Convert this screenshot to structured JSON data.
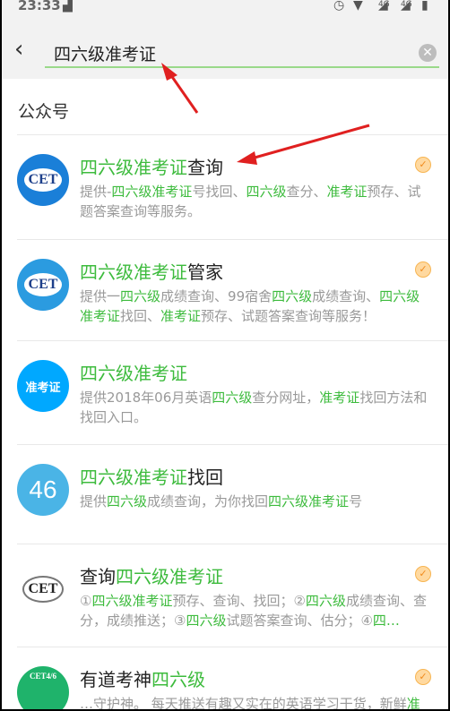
{
  "status_bar": {
    "time": "23:33",
    "icons": [
      "image-icon",
      "alarm-icon",
      "wifi-icon",
      "signal-icon",
      "signal-icon",
      "battery-charging-icon"
    ],
    "network_labels": [
      "4G",
      "4G"
    ]
  },
  "search": {
    "query": "四六级准考证",
    "back_icon": "chevron-left-icon",
    "clear_icon": "clear-icon"
  },
  "section_title": "公众号",
  "colors": {
    "highlight": "#3dbb3d",
    "underline": "#9ad98a",
    "verified": "#f7b552",
    "annotation_arrow": "#e02020"
  },
  "items": [
    {
      "avatar": {
        "text": "CET",
        "bg": "#1a7fd8"
      },
      "verified": true,
      "title": [
        [
          "四六级准考证",
          1
        ],
        [
          "查询",
          0
        ]
      ],
      "desc": [
        [
          "提供-",
          0
        ],
        [
          "四六级准考证",
          1
        ],
        [
          "号找回、",
          0
        ],
        [
          "四六级",
          1
        ],
        [
          "查分、",
          0
        ],
        [
          "准考证",
          1
        ],
        [
          "预存、试题答案查询等服务。",
          0
        ]
      ]
    },
    {
      "avatar": {
        "text": "CET",
        "bg": "#2b9be0"
      },
      "verified": true,
      "title": [
        [
          "四六级准考证",
          1
        ],
        [
          "管家",
          0
        ]
      ],
      "desc": [
        [
          "提供一",
          0
        ],
        [
          "四六级",
          1
        ],
        [
          "成绩查询、99宿舍",
          0
        ],
        [
          "四六级",
          1
        ],
        [
          "成绩查询、",
          0
        ],
        [
          "四六级准考证",
          1
        ],
        [
          "找回、",
          0
        ],
        [
          "准考证",
          1
        ],
        [
          "预存、试题答案查询等服务！",
          0
        ]
      ]
    },
    {
      "avatar": {
        "text": "准考证",
        "bg": "#00a8ff"
      },
      "verified": false,
      "title": [
        [
          "四六级准考证",
          1
        ]
      ],
      "desc": [
        [
          "提供2018年06月英语",
          0
        ],
        [
          "四六级",
          1
        ],
        [
          "查分网址，",
          0
        ],
        [
          "准考证",
          1
        ],
        [
          "找回方法和找回入口。",
          0
        ]
      ]
    },
    {
      "avatar": {
        "text": "46",
        "bg": "#4ab4e6"
      },
      "verified": false,
      "title": [
        [
          "四六级准考证",
          1
        ],
        [
          "找回",
          0
        ]
      ],
      "desc": [
        [
          "提供",
          0
        ],
        [
          "四六级",
          1
        ],
        [
          "成绩查询，为你找回",
          0
        ],
        [
          "四六级准考证",
          1
        ],
        [
          "号",
          0
        ]
      ]
    },
    {
      "avatar": {
        "text": "CET",
        "bg": "#ffffff"
      },
      "verified": true,
      "title": [
        [
          "查询",
          0
        ],
        [
          "四六级准考证",
          1
        ]
      ],
      "desc": [
        [
          "①",
          0
        ],
        [
          "四六级准考证",
          1
        ],
        [
          "预存、查询、找回；②",
          0
        ],
        [
          "四六级",
          1
        ],
        [
          "成绩查询、查分，成绩推送；③",
          0
        ],
        [
          "四六级",
          1
        ],
        [
          "试题答案查询、估分；④",
          0
        ],
        [
          "四…",
          1
        ]
      ]
    },
    {
      "avatar": {
        "text": "CET4/6",
        "bg": "#1fb36b"
      },
      "verified": true,
      "title": [
        [
          "有道考神",
          0
        ],
        [
          "四六级",
          1
        ]
      ],
      "desc": [
        [
          "…守护神。 每天推送有趣又实在的英语学习干货，新鲜",
          0
        ],
        [
          "准",
          1
        ]
      ]
    }
  ]
}
